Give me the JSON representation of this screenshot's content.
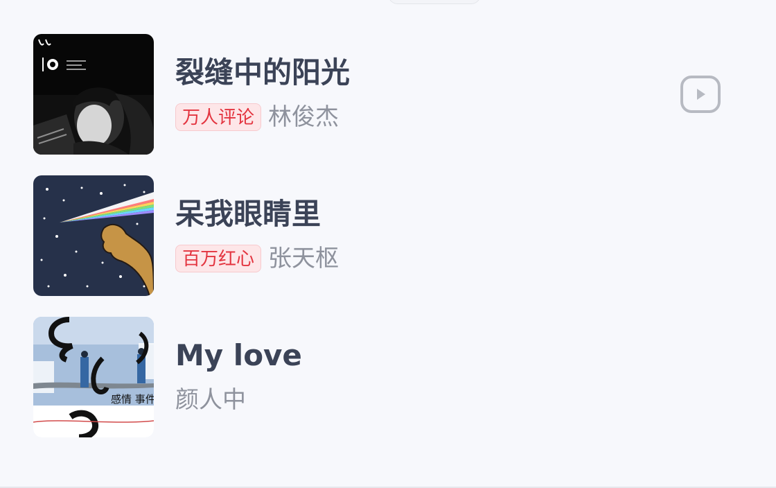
{
  "songs": [
    {
      "title": "裂缝中的阳光",
      "tag": "万人评论",
      "artist": "林俊杰",
      "play_icon": "play-icon"
    },
    {
      "title": "呆我眼睛里",
      "tag": "百万红心",
      "artist": "张天枢"
    },
    {
      "title": "My love",
      "artist": "颜人中",
      "cover_text": "感情 事件"
    }
  ],
  "colors": {
    "background": "#f7f8fc",
    "title": "#3b4357",
    "artist": "#8e929d",
    "tag_text": "#e3343f",
    "tag_bg": "#fde6e8",
    "play_icon": "#b7bac2"
  }
}
